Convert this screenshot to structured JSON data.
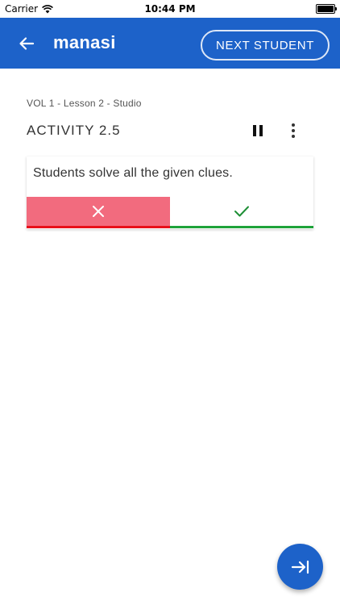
{
  "status_bar": {
    "carrier": "Carrier",
    "time": "10:44 PM",
    "icons": [
      "wifi-icon",
      "battery-icon"
    ]
  },
  "app_bar": {
    "title": "manasi",
    "next_button_label": "NEXT STUDENT",
    "back_icon": "arrow-left-icon",
    "color": "#1d62c9"
  },
  "lesson": {
    "breadcrumb": "VOL 1 - Lesson 2 - Studio",
    "activity_title": "ACTIVITY 2.5",
    "actions": [
      "pause-icon",
      "more-vertical-icon"
    ]
  },
  "card": {
    "text": "Students solve all the given clues.",
    "wrong_icon": "close-icon",
    "right_icon": "check-icon",
    "wrong_color": "#f26b7e",
    "wrong_underline": "#e8101a",
    "right_underline": "#1ea33a"
  },
  "fab": {
    "icon": "skip-to-end-icon"
  }
}
